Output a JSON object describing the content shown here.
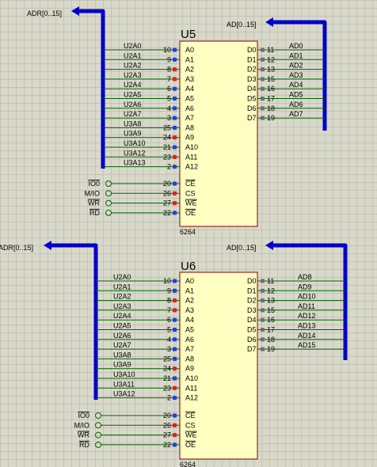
{
  "chips": [
    {
      "ref": "U5",
      "part": "6264",
      "addr_bus_label": "ADR[0..15]",
      "data_bus_label": "AD[0..15]",
      "addr_nets": [
        "U2A0",
        "U2A1",
        "U2A2",
        "U2A3",
        "U2A4",
        "U2A5",
        "U2A6",
        "U2A7",
        "U3A8",
        "U3A9",
        "U3A10",
        "U3A12",
        "U3A13"
      ],
      "addr_pins": [
        "10",
        "9",
        "8",
        "7",
        "6",
        "5",
        "4",
        "3",
        "25",
        "24",
        "21",
        "23",
        "2"
      ],
      "addr_names": [
        "A0",
        "A1",
        "A2",
        "A3",
        "A4",
        "A5",
        "A6",
        "A7",
        "A8",
        "A9",
        "A10",
        "A11",
        "A12"
      ],
      "data_pins": [
        "11",
        "12",
        "13",
        "15",
        "16",
        "17",
        "18",
        "19"
      ],
      "data_names": [
        "D0",
        "D1",
        "D2",
        "D3",
        "D4",
        "D5",
        "D6",
        "D7"
      ],
      "data_nets": [
        "AD0",
        "AD1",
        "AD2",
        "AD3",
        "AD4",
        "AD5",
        "AD6",
        "AD7"
      ],
      "ctrl_pins": [
        "20",
        "26",
        "27",
        "22"
      ],
      "ctrl_names": [
        "CE",
        "CS",
        "WE",
        "OE"
      ],
      "ctrl_nets": [
        "IO0",
        "M/IO",
        "WR",
        "RD"
      ]
    },
    {
      "ref": "U6",
      "part": "6264",
      "addr_bus_label": "ADR[0..15]",
      "data_bus_label": "AD[0..15]",
      "addr_nets": [
        "U2A0",
        "U2A1",
        "U2A2",
        "U2A3",
        "U2A4",
        "U2A5",
        "U2A6",
        "U2A7",
        "U3A8",
        "U3A9",
        "U3A10",
        "U3A11",
        "U3A12"
      ],
      "addr_pins": [
        "10",
        "9",
        "8",
        "7",
        "6",
        "5",
        "4",
        "3",
        "25",
        "24",
        "21",
        "23",
        "2"
      ],
      "addr_names": [
        "A0",
        "A1",
        "A2",
        "A3",
        "A4",
        "A5",
        "A6",
        "A7",
        "A8",
        "A9",
        "A10",
        "A11",
        "A12"
      ],
      "data_pins": [
        "11",
        "12",
        "13",
        "15",
        "16",
        "17",
        "18",
        "19"
      ],
      "data_names": [
        "D0",
        "D1",
        "D2",
        "D3",
        "D4",
        "D5",
        "D6",
        "D7"
      ],
      "data_nets": [
        "AD8",
        "AD9",
        "AD10",
        "AD11",
        "AD12",
        "AD13",
        "AD14",
        "AD15"
      ],
      "ctrl_pins": [
        "20",
        "26",
        "27",
        "22"
      ],
      "ctrl_names": [
        "CE",
        "CS",
        "WE",
        "OE"
      ],
      "ctrl_nets": [
        "IO0",
        "M/IO",
        "WR",
        "RD"
      ]
    }
  ],
  "colors": {
    "chip_fill": "#ffffc2",
    "chip_border": "#8b0000",
    "wire": "#006400",
    "bus": "#0000c8",
    "pin_blue": "#2040e0",
    "pin_red": "#e02020",
    "pin_gray": "#707070"
  }
}
